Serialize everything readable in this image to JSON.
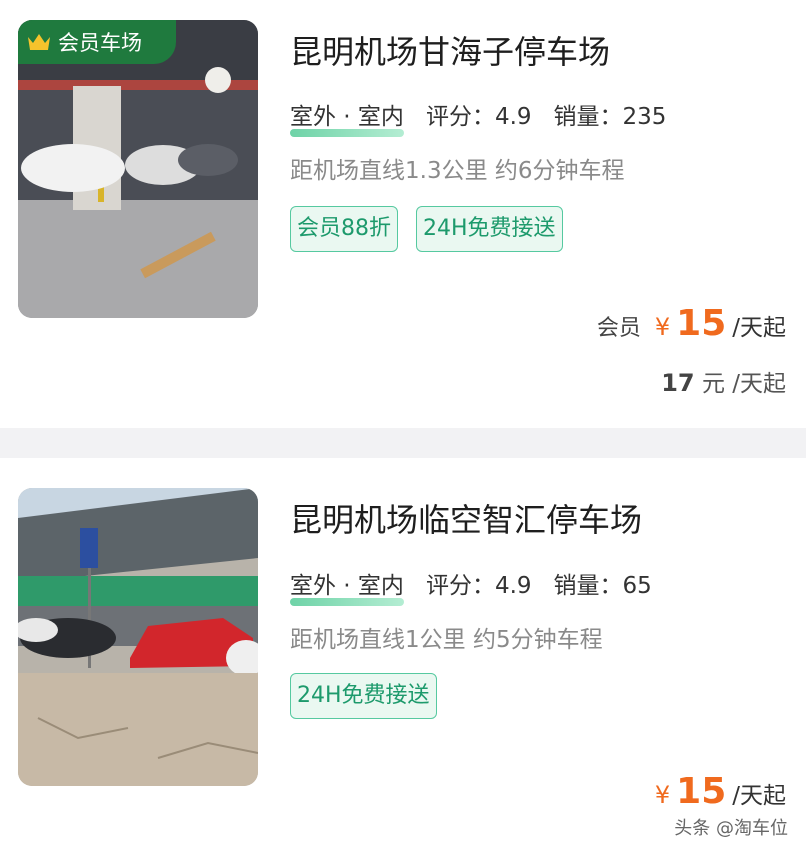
{
  "listings": [
    {
      "title": "昆明机场甘海子停车场",
      "badge": "会员车场",
      "location": "室外 · 室内",
      "rating_label": "评分：",
      "rating": "4.9",
      "sales_label": "销量：",
      "sales": "235",
      "distance": "距机场直线1.3公里 约6分钟车程",
      "tags": [
        "会员88折",
        "24H免费接送"
      ],
      "price_label": "会员",
      "currency": "¥",
      "price": "15",
      "price_unit": "/天起",
      "original_price": "17",
      "original_unit": "元 /天起",
      "photo": "indoor-parking-photo"
    },
    {
      "title": "昆明机场临空智汇停车场",
      "location": "室外 · 室内",
      "rating_label": "评分：",
      "rating": "4.9",
      "sales_label": "销量：",
      "sales": "65",
      "distance": "距机场直线1公里 约5分钟车程",
      "tags": [
        "24H免费接送"
      ],
      "currency": "¥",
      "price": "15",
      "price_unit": "/天起",
      "photo": "outdoor-parking-photo"
    }
  ],
  "watermark": "头条 @淘车位",
  "colors": {
    "accent_green": "#1d9a6c",
    "price_orange": "#f06a1e",
    "badge_green": "#1f7a3e"
  }
}
